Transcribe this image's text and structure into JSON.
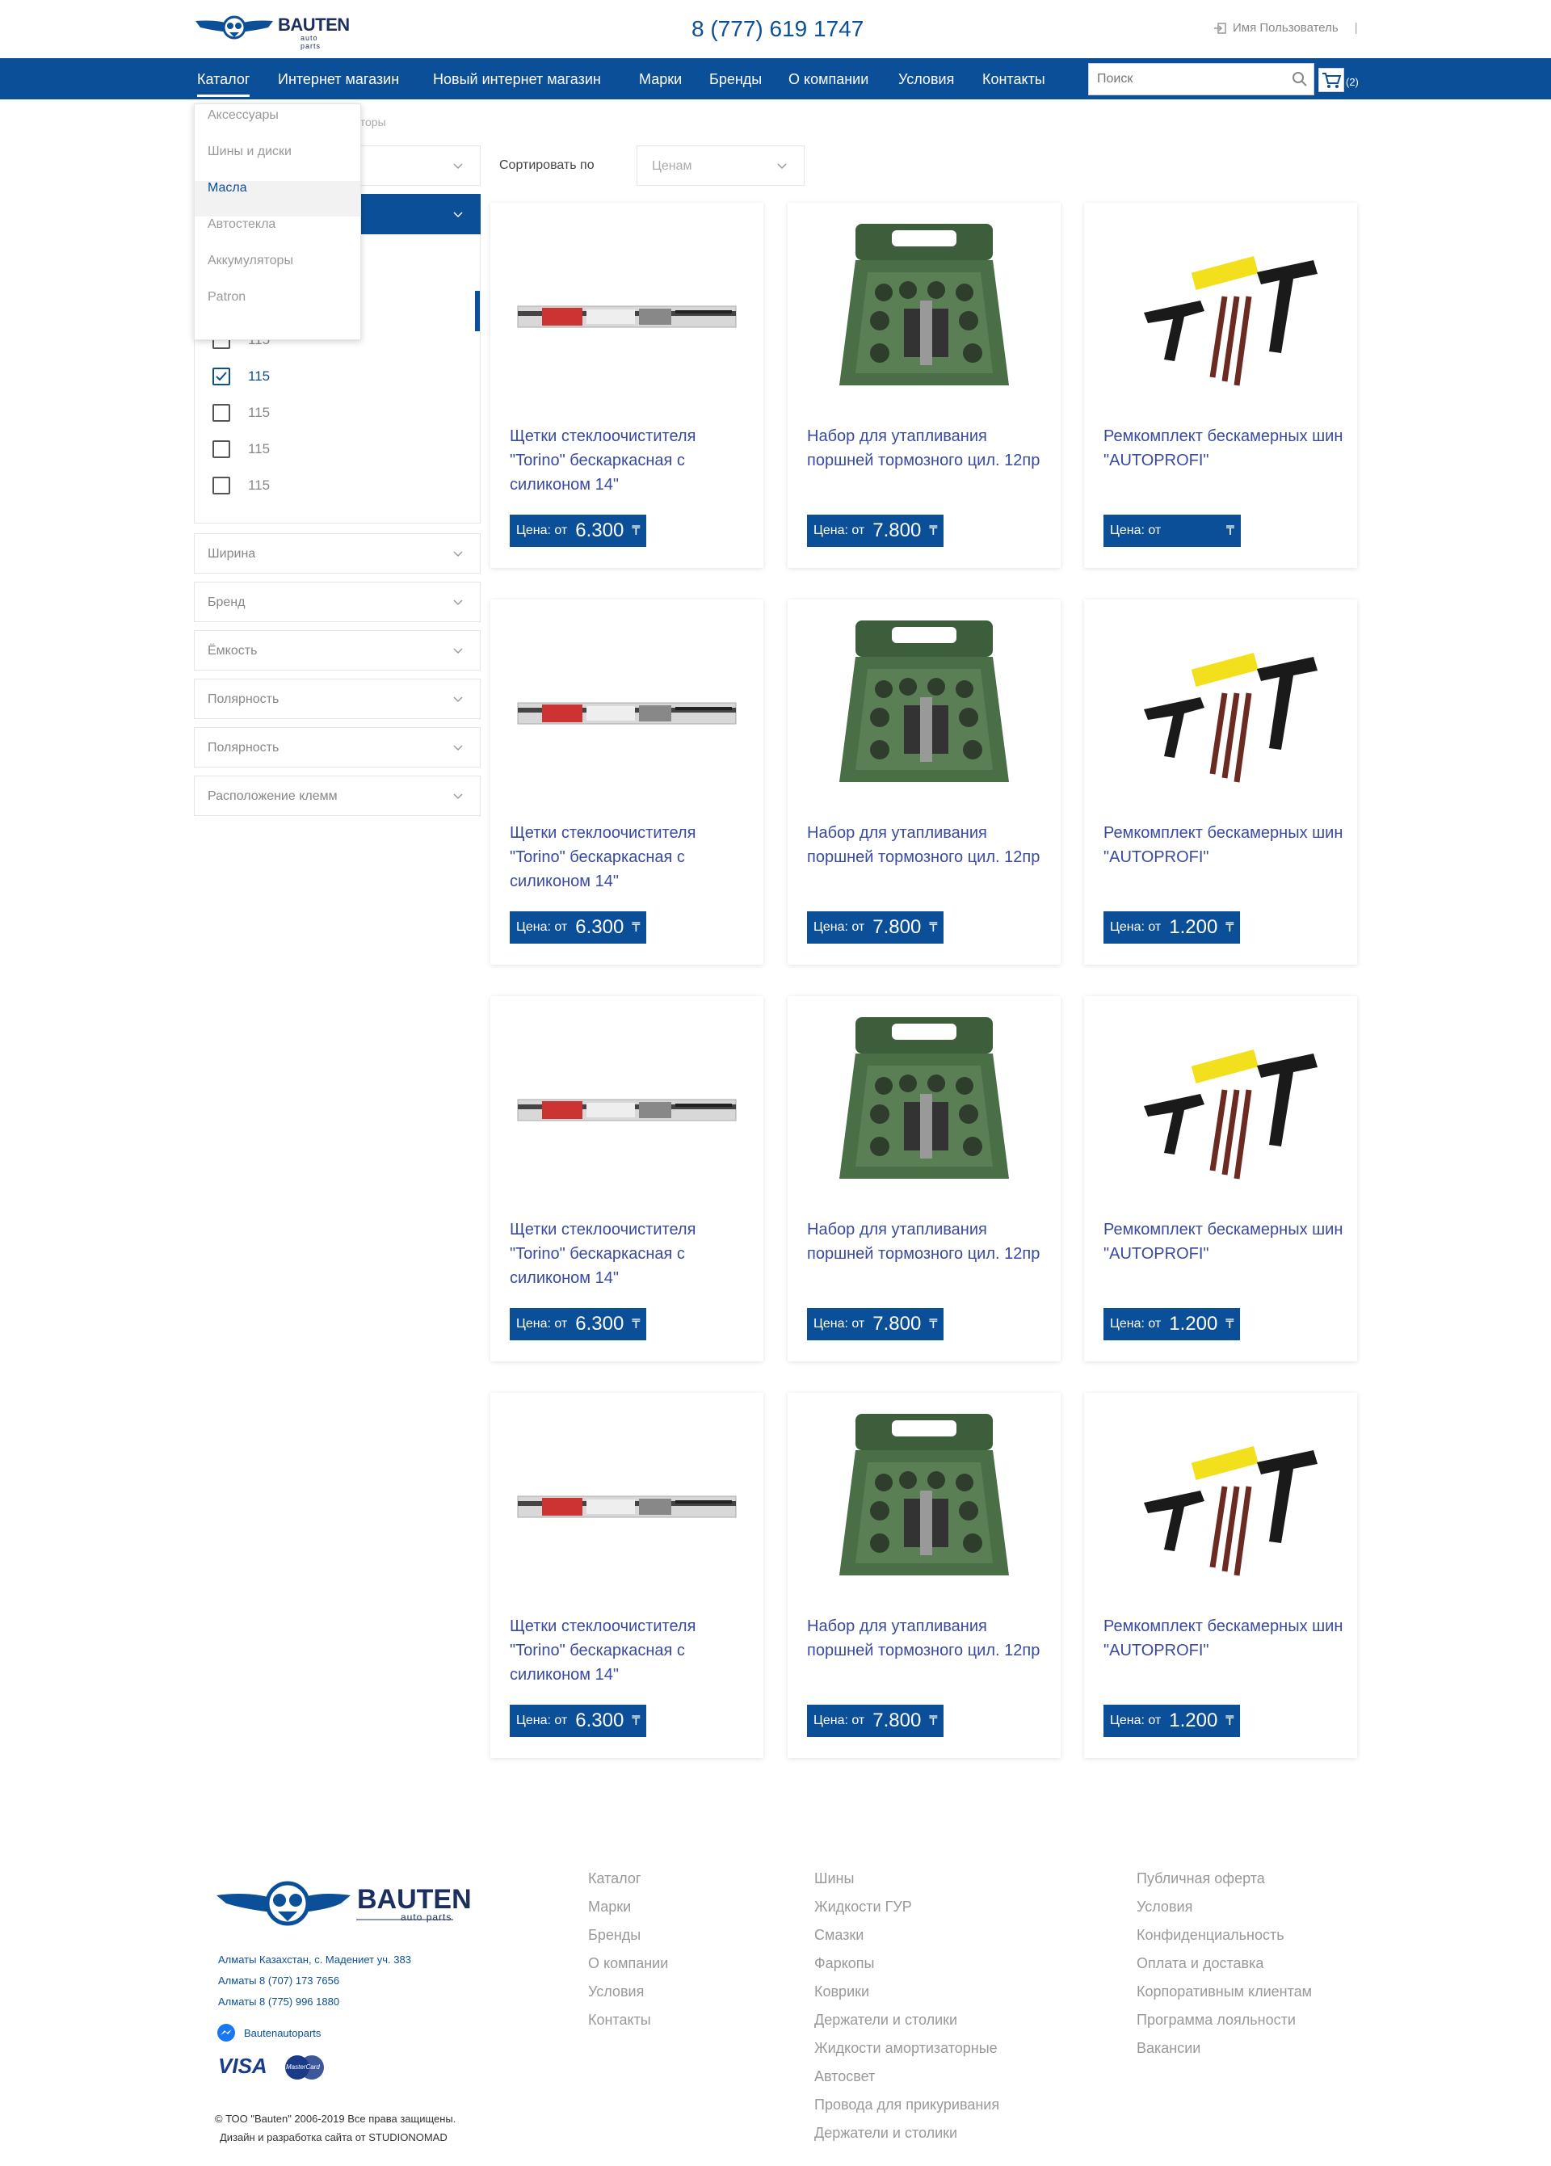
{
  "header": {
    "logo_text": "BAUTEN",
    "logo_sub": "auto parts",
    "phone": "8 (777) 619 1747",
    "user_label": "Имя Пользователь",
    "user_sep": "|"
  },
  "nav": {
    "items": [
      "Каталог",
      "Интернет магазин",
      "Новый интернет магазин",
      "Марки",
      "Бренды",
      "О компании",
      "Условия",
      "Контакты"
    ],
    "search_placeholder": "Поиск",
    "cart_count": "(2)"
  },
  "breadcrumb": "ляторы",
  "dropdown": {
    "items": [
      "Аксессуары",
      "Шины и диски",
      "Масла",
      "Автостекла",
      "Аккумуляторы",
      "Patron"
    ],
    "active_index": 2
  },
  "filters": {
    "checkboxes": [
      {
        "label": "115",
        "checked": false
      },
      {
        "label": "115",
        "checked": true
      },
      {
        "label": "115",
        "checked": false
      },
      {
        "label": "115",
        "checked": false
      },
      {
        "label": "115",
        "checked": false
      }
    ],
    "groups": [
      "Ширина",
      "Бренд",
      "Ёмкость",
      "Полярность",
      "Полярность",
      "Расположение клемм"
    ]
  },
  "sort": {
    "label": "Сортировать по",
    "value": "Ценам"
  },
  "products": [
    {
      "type": "wiper",
      "title": "Щетки стеклоочистителя \"Torino\" бескаркасная с силиконом 14\"",
      "price_label": "Цена: от",
      "price": "6.300",
      "currency": "₸"
    },
    {
      "type": "case",
      "title": "Набор для утапливания поршней тормозного цил. 12пр",
      "price_label": "Цена: от",
      "price": "7.800",
      "currency": "₸"
    },
    {
      "type": "repair",
      "title": "Ремкомплект бескамерных шин \"AUTOPROFI\"",
      "price_label": "Цена: от",
      "price": "",
      "currency": "₸"
    },
    {
      "type": "wiper",
      "title": "Щетки стеклоочистителя \"Torino\" бескаркасная с силиконом 14\"",
      "price_label": "Цена: от",
      "price": "6.300",
      "currency": "₸"
    },
    {
      "type": "case",
      "title": "Набор для утапливания поршней тормозного цил. 12пр",
      "price_label": "Цена: от",
      "price": "7.800",
      "currency": "₸"
    },
    {
      "type": "repair",
      "title": "Ремкомплект бескамерных шин \"AUTOPROFI\"",
      "price_label": "Цена: от",
      "price": "1.200",
      "currency": "₸"
    },
    {
      "type": "wiper",
      "title": "Щетки стеклоочистителя \"Torino\" бескаркасная с силиконом 14\"",
      "price_label": "Цена: от",
      "price": "6.300",
      "currency": "₸"
    },
    {
      "type": "case",
      "title": "Набор для утапливания поршней тормозного цил. 12пр",
      "price_label": "Цена: от",
      "price": "7.800",
      "currency": "₸"
    },
    {
      "type": "repair",
      "title": "Ремкомплект бескамерных шин \"AUTOPROFI\"",
      "price_label": "Цена: от",
      "price": "1.200",
      "currency": "₸"
    },
    {
      "type": "wiper",
      "title": "Щетки стеклоочистителя \"Torino\" бескаркасная с силиконом 14\"",
      "price_label": "Цена: от",
      "price": "6.300",
      "currency": "₸"
    },
    {
      "type": "case",
      "title": "Набор для утапливания поршней тормозного цил. 12пр",
      "price_label": "Цена: от",
      "price": "7.800",
      "currency": "₸"
    },
    {
      "type": "repair",
      "title": "Ремкомплект бескамерных шин \"AUTOPROFI\"",
      "price_label": "Цена: от",
      "price": "1.200",
      "currency": "₸"
    }
  ],
  "footer": {
    "address": [
      "Алматы Казахстан, с. Мадениет уч. 383",
      "Алматы  8 (707) 173 7656",
      "Алматы 8 (775) 996 1880"
    ],
    "messenger": "Bautenautoparts",
    "visa": "VISA",
    "mastercard": "MasterCard",
    "col1": [
      "Каталог",
      "Марки",
      "Бренды",
      "О компании",
      "Условия",
      "Контакты"
    ],
    "col2": [
      "Шины",
      "Жидкости ГУР",
      "Смазки",
      "Фаркопы",
      "Коврики",
      "Держатели и столики",
      "Жидкости амортизаторные",
      "Автосвет",
      "Провода для прикуривания",
      "Держатели и столики"
    ],
    "col3": [
      "Публичная оферта",
      "Условия",
      "Конфиденциальность",
      "Оплата и доставка",
      "Корпоративным клиентам",
      "Программа лояльности",
      "Вакансии"
    ],
    "copyright": "© ТОО \"Bauten\" 2006-2019 Все права защищены.",
    "design": "Дизайн и разработка сайта от  STUDIONOMAD"
  },
  "colors": {
    "brand": "#0b4f99",
    "title": "#3a4aa0"
  }
}
